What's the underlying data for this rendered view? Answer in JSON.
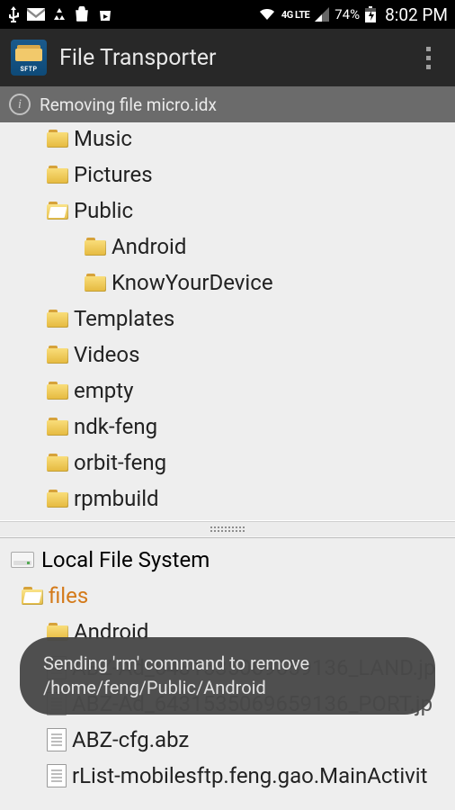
{
  "status": {
    "network_label": "4G LTE",
    "battery_pct": "74%",
    "time": "8:02 PM"
  },
  "app": {
    "title": "File Transporter",
    "icon_label": "SFTP"
  },
  "info_bar": {
    "message": "Removing file micro.idx"
  },
  "remote_tree": [
    {
      "name": "Music",
      "type": "folder",
      "level": 1
    },
    {
      "name": "Pictures",
      "type": "folder",
      "level": 1
    },
    {
      "name": "Public",
      "type": "folder-open",
      "level": 1
    },
    {
      "name": "Android",
      "type": "folder",
      "level": 2
    },
    {
      "name": "KnowYourDevice",
      "type": "folder",
      "level": 2
    },
    {
      "name": "Templates",
      "type": "folder",
      "level": 1
    },
    {
      "name": "Videos",
      "type": "folder",
      "level": 1
    },
    {
      "name": "empty",
      "type": "folder",
      "level": 1
    },
    {
      "name": "ndk-feng",
      "type": "folder",
      "level": 1
    },
    {
      "name": "orbit-feng",
      "type": "folder",
      "level": 1
    },
    {
      "name": "rpmbuild",
      "type": "folder",
      "level": 1
    }
  ],
  "local": {
    "header": "Local File System",
    "tree": [
      {
        "name": "files",
        "type": "folder-open",
        "level": 0,
        "selected": true
      },
      {
        "name": "Android",
        "type": "folder",
        "level": 1
      },
      {
        "name": "ABZ-Ad_6431535069659136_LAND.jp",
        "type": "file",
        "level": 1,
        "under": true
      },
      {
        "name": "ABZ-Ad_6431535069659136_PORT.jp",
        "type": "file",
        "level": 1,
        "under": true
      },
      {
        "name": "ABZ-cfg.abz",
        "type": "file",
        "level": 1
      },
      {
        "name": "rList-mobilesftp.feng.gao.MainActivit",
        "type": "file",
        "level": 1
      }
    ]
  },
  "toast": {
    "message": "Sending 'rm' command to remove /home/feng/Public/Android"
  }
}
